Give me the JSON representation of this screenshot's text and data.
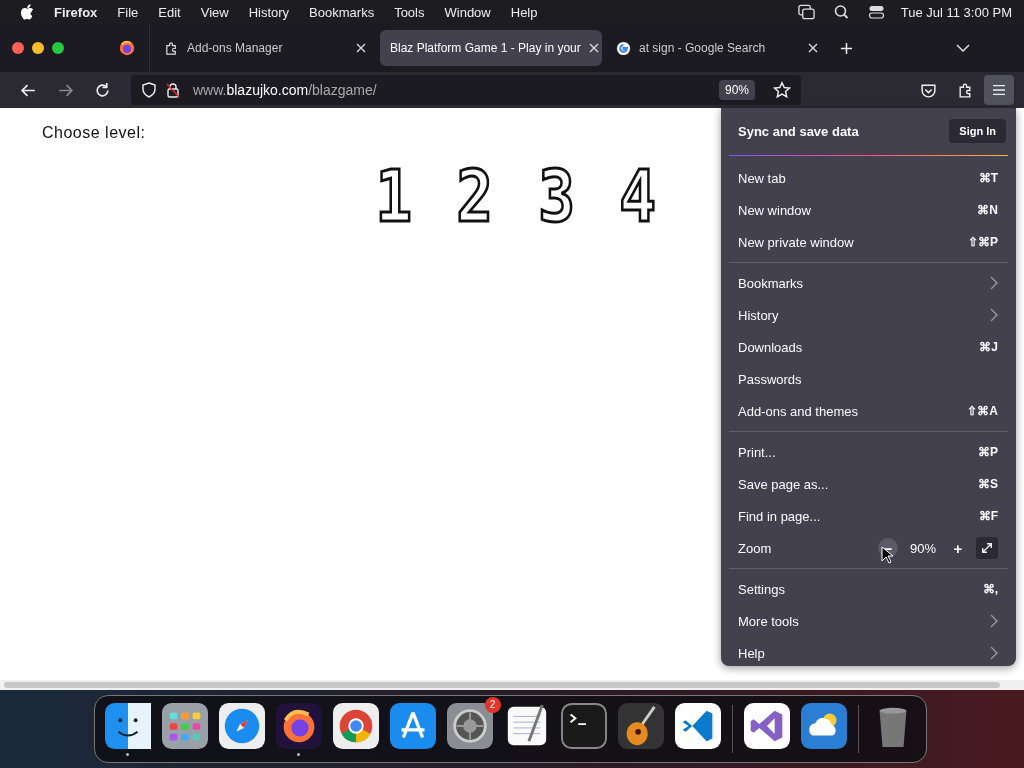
{
  "menubar": {
    "app": "Firefox",
    "items": [
      "File",
      "Edit",
      "View",
      "History",
      "Bookmarks",
      "Tools",
      "Window",
      "Help"
    ],
    "clock": "Tue Jul 11  3:00 PM"
  },
  "tabs": [
    {
      "title": "Add-ons Manager",
      "selected": false
    },
    {
      "title": "Blaz Platform Game 1 - Play in your",
      "selected": true
    },
    {
      "title": "at sign - Google Search",
      "selected": false
    }
  ],
  "address": {
    "prefix": "www.",
    "domain": "blazujko.com",
    "path": "/blazgame/",
    "zoom": "90%"
  },
  "page": {
    "heading": "Choose level:",
    "levels": [
      "1",
      "2",
      "3",
      "4"
    ]
  },
  "menu": {
    "sync": {
      "title": "Sync and save data",
      "button": "Sign In"
    },
    "groups": [
      [
        {
          "kind": "shortcut",
          "label": "New tab",
          "shortcut": "⌘T"
        },
        {
          "kind": "shortcut",
          "label": "New window",
          "shortcut": "⌘N"
        },
        {
          "kind": "shortcut",
          "label": "New private window",
          "shortcut": "⇧⌘P"
        }
      ],
      [
        {
          "kind": "submenu",
          "label": "Bookmarks"
        },
        {
          "kind": "submenu",
          "label": "History"
        },
        {
          "kind": "shortcut",
          "label": "Downloads",
          "shortcut": "⌘J"
        },
        {
          "kind": "plain",
          "label": "Passwords"
        },
        {
          "kind": "shortcut",
          "label": "Add-ons and themes",
          "shortcut": "⇧⌘A"
        }
      ],
      [
        {
          "kind": "shortcut",
          "label": "Print...",
          "shortcut": "⌘P"
        },
        {
          "kind": "shortcut",
          "label": "Save page as...",
          "shortcut": "⌘S"
        },
        {
          "kind": "shortcut",
          "label": "Find in page...",
          "shortcut": "⌘F"
        },
        {
          "kind": "zoom",
          "label": "Zoom",
          "minus": "−",
          "value": "90%",
          "plus": "+"
        }
      ],
      [
        {
          "kind": "shortcut",
          "label": "Settings",
          "shortcut": "⌘,"
        },
        {
          "kind": "submenu",
          "label": "More tools"
        },
        {
          "kind": "submenu",
          "label": "Help"
        }
      ]
    ]
  },
  "dock": [
    {
      "running": true
    },
    {
      "running": false
    },
    {
      "running": false
    },
    {
      "running": true
    },
    {
      "running": false
    },
    {
      "running": false
    },
    {
      "running": false,
      "badge": "2"
    },
    {
      "running": false
    },
    {
      "running": false
    },
    {
      "running": false
    },
    {
      "running": false
    },
    {
      "running": false
    },
    {
      "running": false
    },
    {
      "running": false
    }
  ]
}
